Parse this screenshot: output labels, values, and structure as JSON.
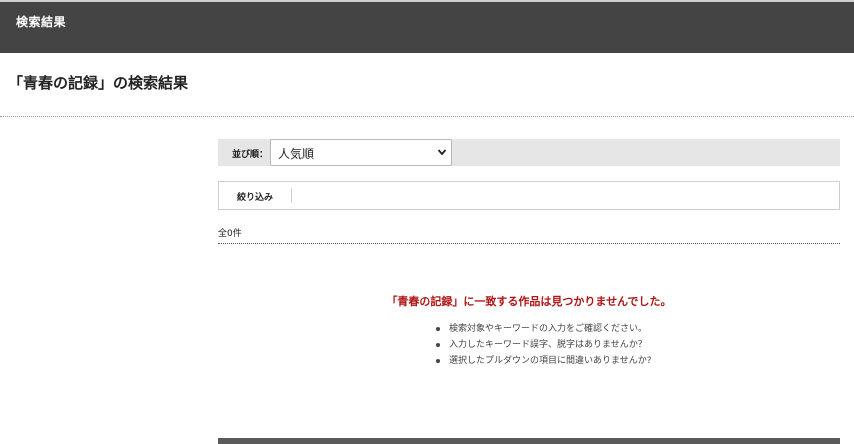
{
  "header": {
    "title": "検索結果"
  },
  "page": {
    "heading": "「青春の記録」の検索結果"
  },
  "sort": {
    "label": "並び順：",
    "selected": "人気順"
  },
  "filter": {
    "label": "絞り込み"
  },
  "results": {
    "count_text": "全0件",
    "no_results_message": "「青春の記録」に一致する作品は見つかりませんでした。",
    "tips": [
      "検索対象やキーワードの入力をご確認ください。",
      "入力したキーワード誤字、脱字はありませんか？",
      "選択したプルダウンの項目に間違いありませんか?"
    ]
  },
  "icons": {
    "sort_dropdown": "chevron-down-icon",
    "tip_bullet": "bullet-dot-icon"
  },
  "colors": {
    "header_bg": "#444444",
    "no_results_text": "#b01515",
    "sort_bar_bg": "#e6e6e6"
  }
}
